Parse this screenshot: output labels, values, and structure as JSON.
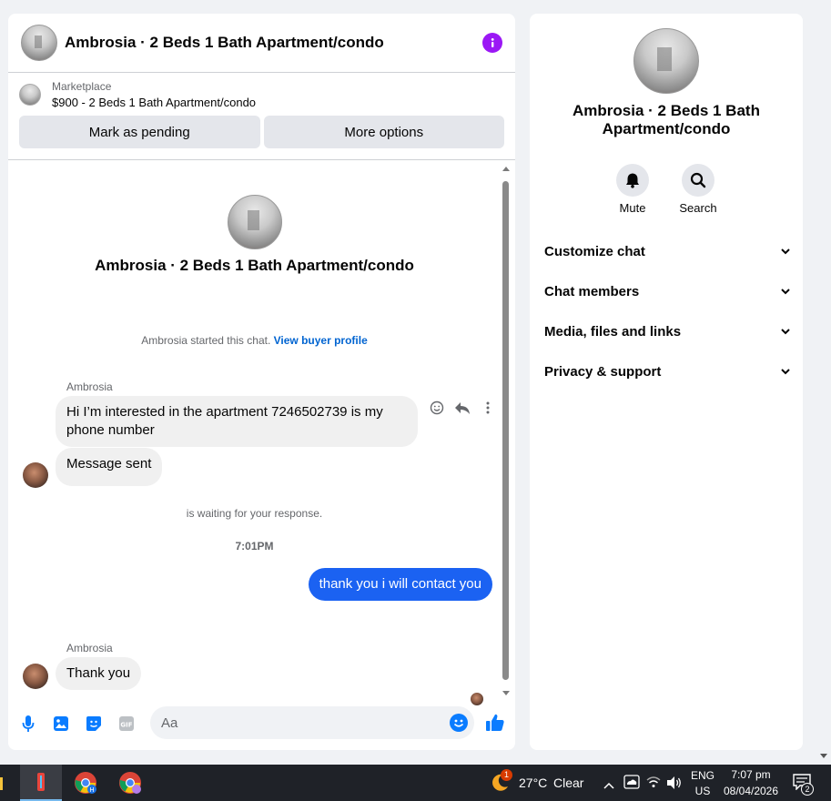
{
  "header": {
    "title": "Ambrosia · 2 Beds 1 Bath Apartment/condo"
  },
  "listing": {
    "category": "Marketplace",
    "price_title": "$900 - 2 Beds 1 Bath Apartment/condo",
    "pending_label": "Mark as pending",
    "more_label": "More options"
  },
  "conversation": {
    "name": "Ambrosia · 2 Beds 1 Bath Apartment/condo",
    "started_text": "Ambrosia started this chat.",
    "buyer_profile_link": "View buyer profile",
    "messages": [
      {
        "sender": "Ambrosia",
        "text": "Hi I’m interested in the apartment 7246502739 is my phone number"
      },
      {
        "text": "Message sent"
      }
    ],
    "waiting_text": "is waiting for your response.",
    "timestamp": "7:01PM",
    "outgoing": "thank you i will contact you",
    "reply": {
      "sender": "Ambrosia",
      "text": "Thank you"
    }
  },
  "composer": {
    "placeholder": "Aa"
  },
  "info_panel": {
    "name": "Ambrosia · 2 Beds 1 Bath Apartment/condo",
    "mute_label": "Mute",
    "search_label": "Search",
    "sections": [
      "Customize chat",
      "Chat members",
      "Media, files and links",
      "Privacy & support"
    ]
  },
  "taskbar": {
    "weather_temp": "27°C",
    "weather_desc": "Clear",
    "lang_top": "ENG",
    "lang_bottom": "US",
    "time": "7:07 pm",
    "date": "08/04/2026",
    "notif_count": "2",
    "weather_badge": "1"
  },
  "colors": {
    "accent": "#1b62f2",
    "info": "#9b18f5",
    "link": "#0064d1"
  }
}
